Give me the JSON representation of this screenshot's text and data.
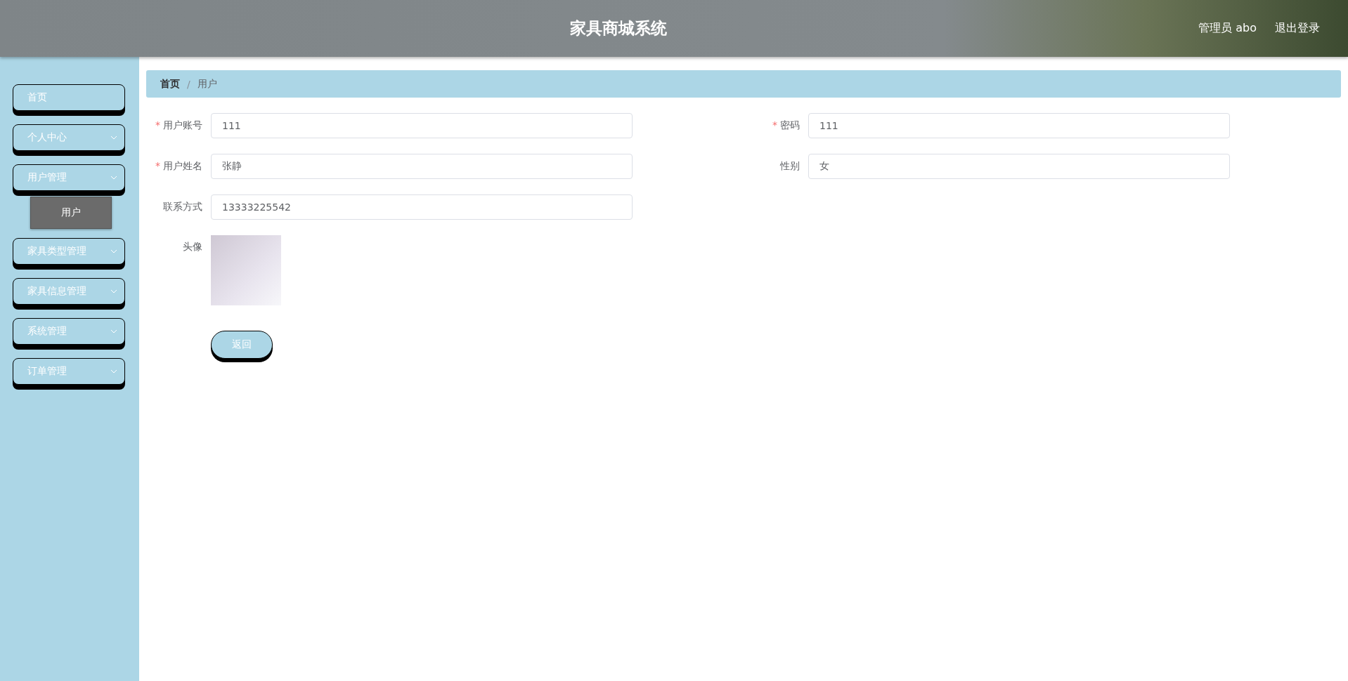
{
  "header": {
    "title": "家具商城系统",
    "user": "管理员 abo",
    "logout": "退出登录"
  },
  "sidebar": {
    "items": [
      {
        "label": "首页",
        "has_children": false
      },
      {
        "label": "个人中心",
        "has_children": true
      },
      {
        "label": "用户管理",
        "has_children": true,
        "children": [
          {
            "label": "用户",
            "selected": true
          }
        ]
      },
      {
        "label": "家具类型管理",
        "has_children": true
      },
      {
        "label": "家具信息管理",
        "has_children": true
      },
      {
        "label": "系统管理",
        "has_children": true
      },
      {
        "label": "订单管理",
        "has_children": true
      }
    ]
  },
  "breadcrumb": {
    "items": [
      "首页",
      "用户"
    ],
    "separators": [
      "/"
    ]
  },
  "form": {
    "fields": [
      {
        "label": "用户账号",
        "value": "111",
        "required_mark": "*"
      },
      {
        "label": "密码",
        "value": "111",
        "required_mark": "*"
      },
      {
        "label": "用户姓名",
        "value": "张静",
        "required_mark": "*"
      },
      {
        "label": "性别",
        "value": "女"
      },
      {
        "label": "联系方式",
        "value": "13333225542"
      }
    ],
    "avatar_label": "头像",
    "back_button": "返回"
  }
}
